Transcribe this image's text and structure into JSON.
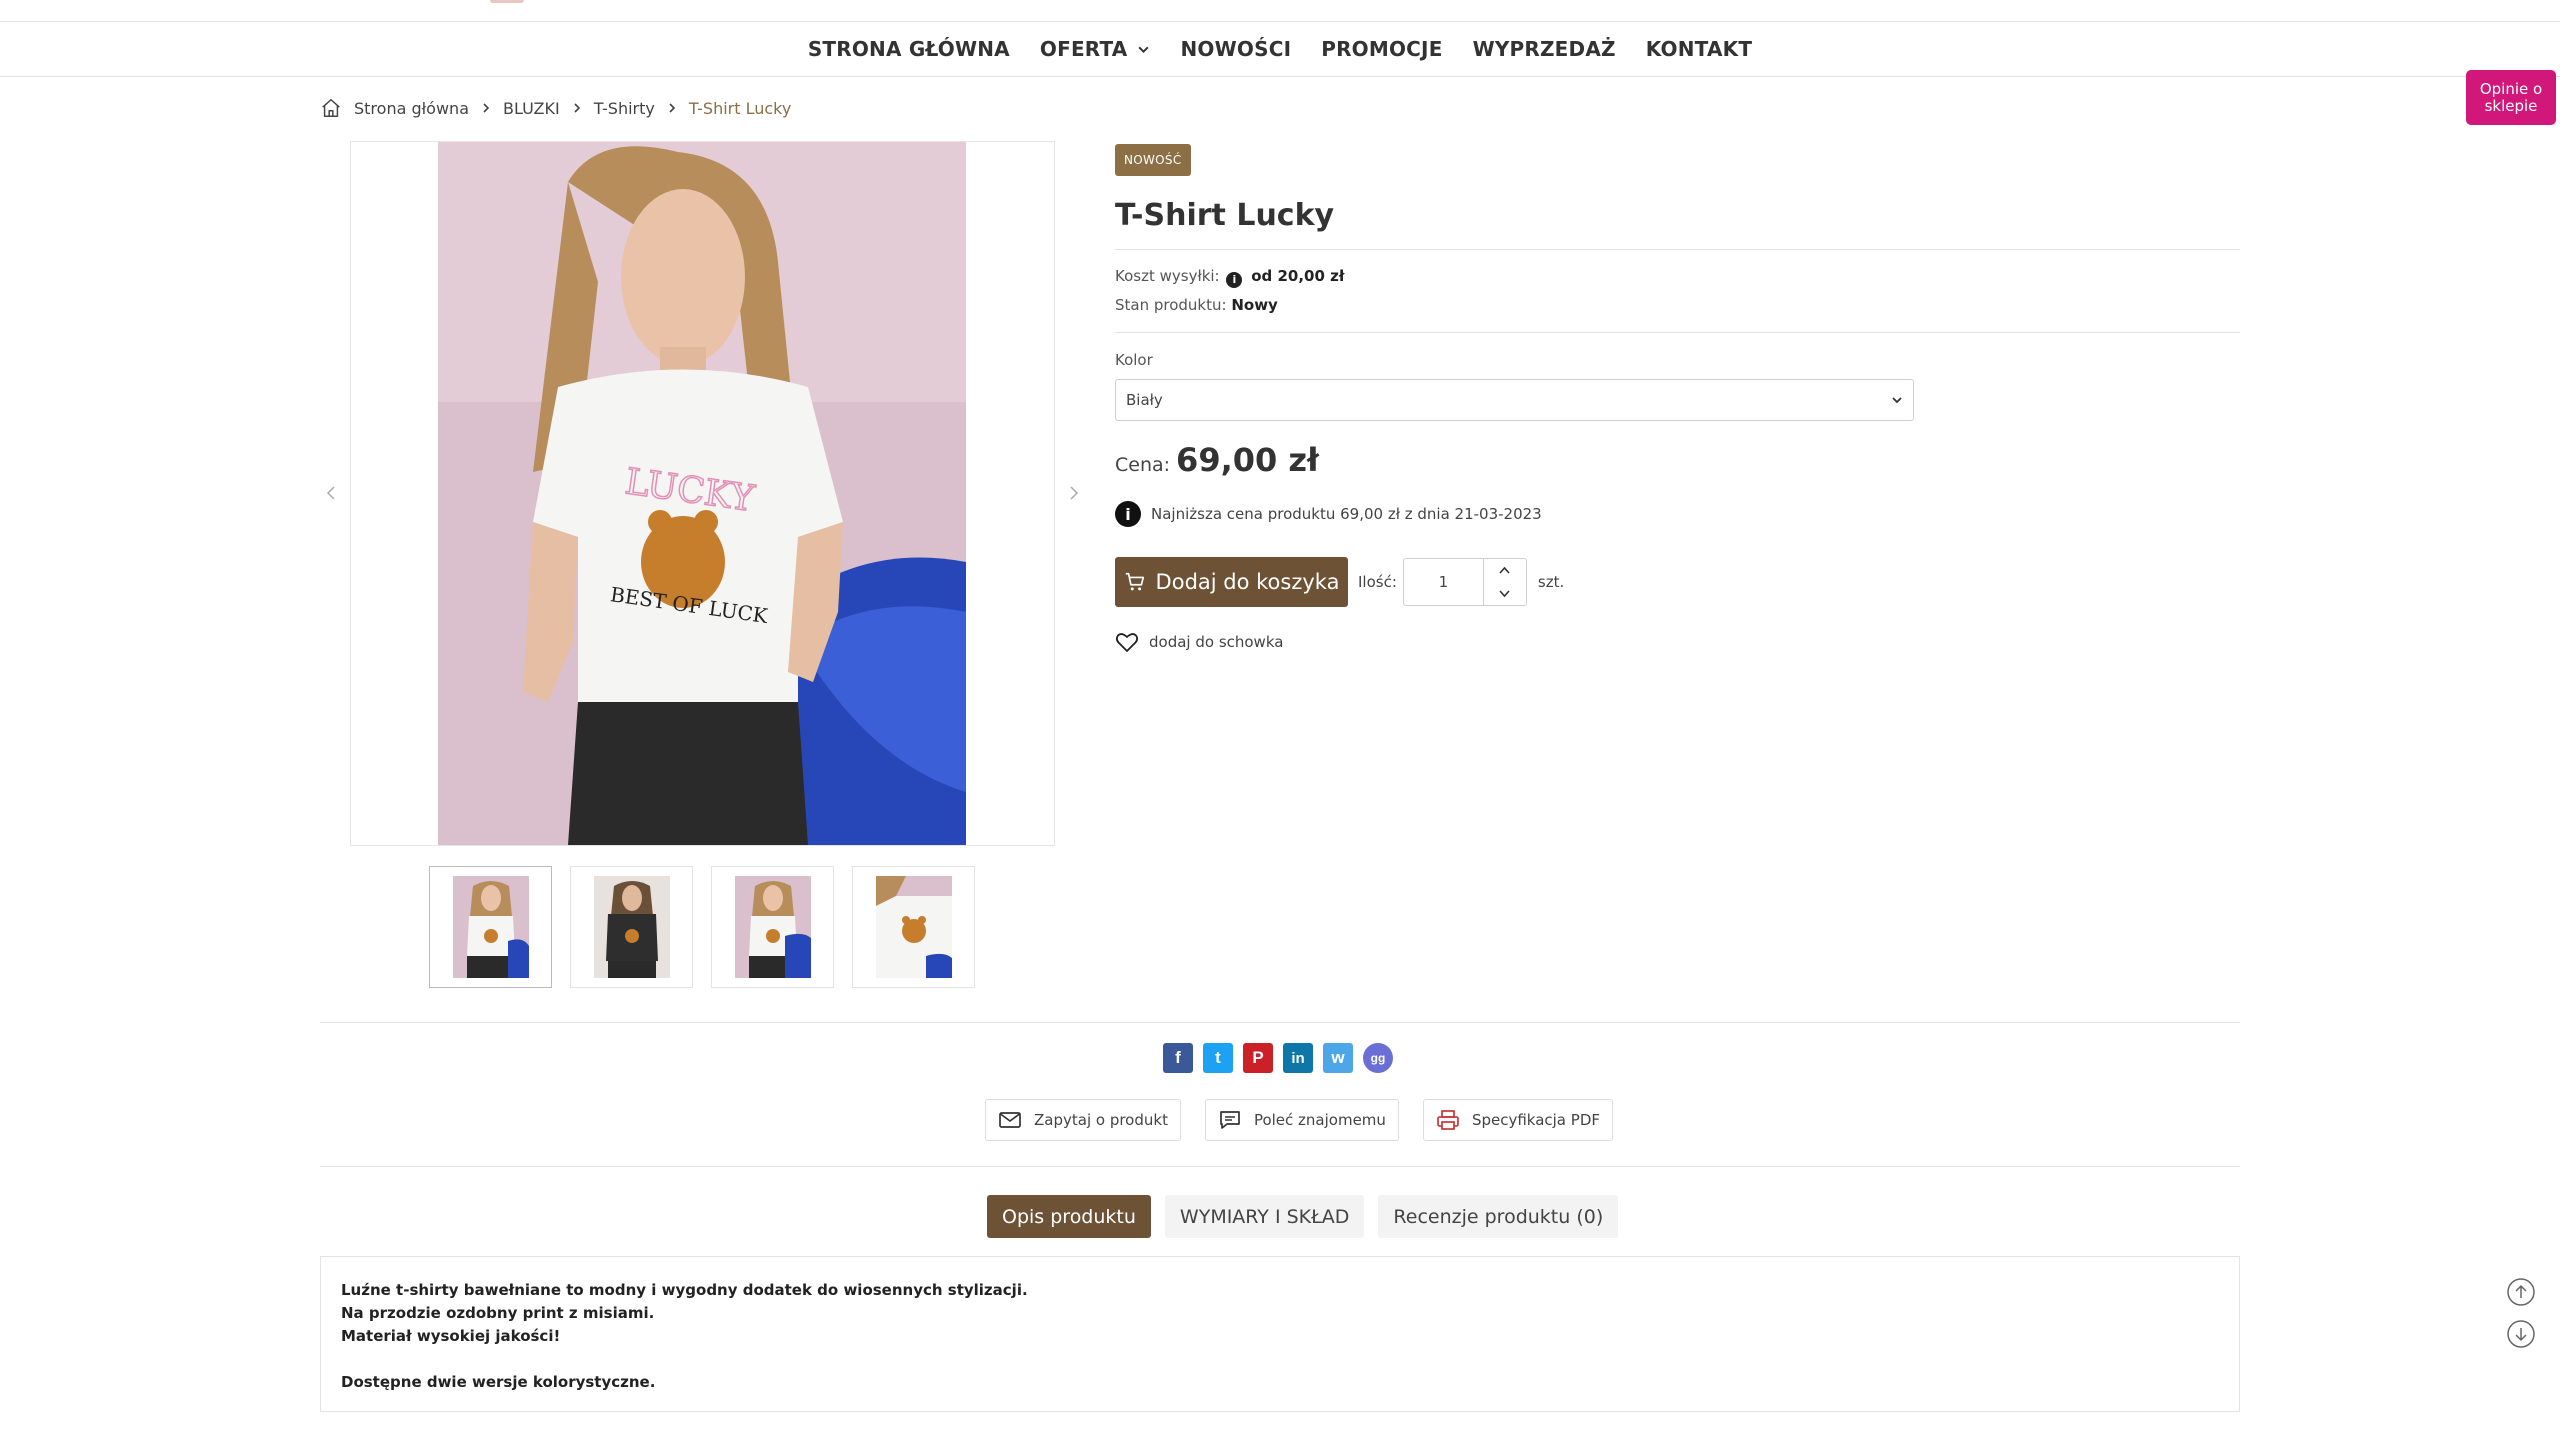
{
  "nav": {
    "items": [
      {
        "label": "STRONA GŁÓWNA"
      },
      {
        "label": "OFERTA"
      },
      {
        "label": "NOWOŚCI"
      },
      {
        "label": "PROMOCJE"
      },
      {
        "label": "WYPRZEDAŻ"
      },
      {
        "label": "KONTAKT"
      }
    ]
  },
  "opinie_label": "Opinie o sklepie",
  "breadcrumb": {
    "home": "Strona główna",
    "level1": "BLUZKI",
    "level2": "T-Shirty",
    "current": "T-Shirt Lucky"
  },
  "product": {
    "badge": "NOWOŚĆ",
    "title": "T-Shirt Lucky",
    "shipping_label": "Koszt wysyłki:",
    "shipping_value": "od 20,00 zł",
    "condition_label": "Stan produktu:",
    "condition_value": "Nowy",
    "color_label": "Kolor",
    "color_selected": "Biały",
    "price_label": "Cena:",
    "price_value": "69,00 zł",
    "lowest_price_note": "Najniższa cena produktu 69,00 zł z dnia 21-03-2023",
    "add_to_cart": "Dodaj do koszyka",
    "qty_label": "Ilość:",
    "qty_value": "1",
    "unit": "szt.",
    "wishlist": "dodaj do schowka",
    "print_text": "LUCKY",
    "print_text2": "BEST OF LUCK"
  },
  "actions": {
    "ask": "Zapytaj o produkt",
    "recommend": "Poleć znajomemu",
    "pdf": "Specyfikacja PDF"
  },
  "social": [
    {
      "icon": "facebook-icon",
      "glyph": "f",
      "color": "#3b5998"
    },
    {
      "icon": "twitter-icon",
      "glyph": "t",
      "color": "#1da1f2"
    },
    {
      "icon": "pinterest-icon",
      "glyph": "P",
      "color": "#cb2027"
    },
    {
      "icon": "linkedin-icon",
      "glyph": "in",
      "color": "#0e76a8"
    },
    {
      "icon": "wykop-icon",
      "glyph": "w",
      "color": "#4da6e7"
    },
    {
      "icon": "gg-icon",
      "glyph": "gg",
      "color": "#6a6fd6"
    }
  ],
  "tabs": [
    {
      "label": "Opis produktu",
      "active": true
    },
    {
      "label": "WYMIARY I SKŁAD",
      "active": false
    },
    {
      "label": "Recenzje produktu (0)",
      "active": false
    }
  ],
  "description": {
    "line1": "Luźne t-shirty bawełniane to modny i wygodny dodatek do wiosennych stylizacji.",
    "line2": "Na przodzie ozdobny print z misiami.",
    "line3": "Materiał wysokiej jakości!",
    "line4": "Dostępne dwie wersje kolorystyczne."
  },
  "colors": {
    "accent_brown": "#6e5236",
    "badge_brown": "#8c6f44",
    "opinie_pink": "#d1177a"
  }
}
